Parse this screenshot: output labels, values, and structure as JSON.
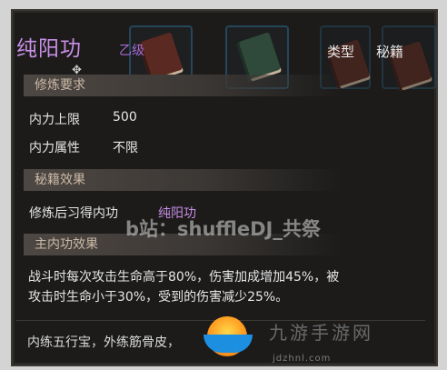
{
  "skill": {
    "name": "纯阳功",
    "grade": "乙级",
    "type_label": "类型",
    "type_value": "秘籍"
  },
  "sections": {
    "requirements": "修炼要求",
    "book_effect": "秘籍效果",
    "main_effect": "主内功效果"
  },
  "requirements": {
    "max_inner_label": "内力上限",
    "max_inner_value": "500",
    "inner_attr_label": "内力属性",
    "inner_attr_value": "不限"
  },
  "book_effect": {
    "text": "修炼后习得内功",
    "skill_link": "纯阳功"
  },
  "main_effect": {
    "line1": "战斗时每次攻击生命高于80%，伤害加成增加45%，被",
    "line2": "攻击时生命小于30%，受到的伤害减少25%。"
  },
  "flavor_text": "内练五行宝，外练筋骨皮，",
  "watermark": "b站：shuffleDJ_共祭",
  "site_watermark": {
    "name": "九游手游网",
    "url": "jdzhnl.com"
  },
  "colors": {
    "title_purple": "#c88fe6",
    "panel_bg": "#1c1b1a"
  },
  "icons": {
    "cursor": "move-cursor-icon",
    "book": "book-icon"
  }
}
